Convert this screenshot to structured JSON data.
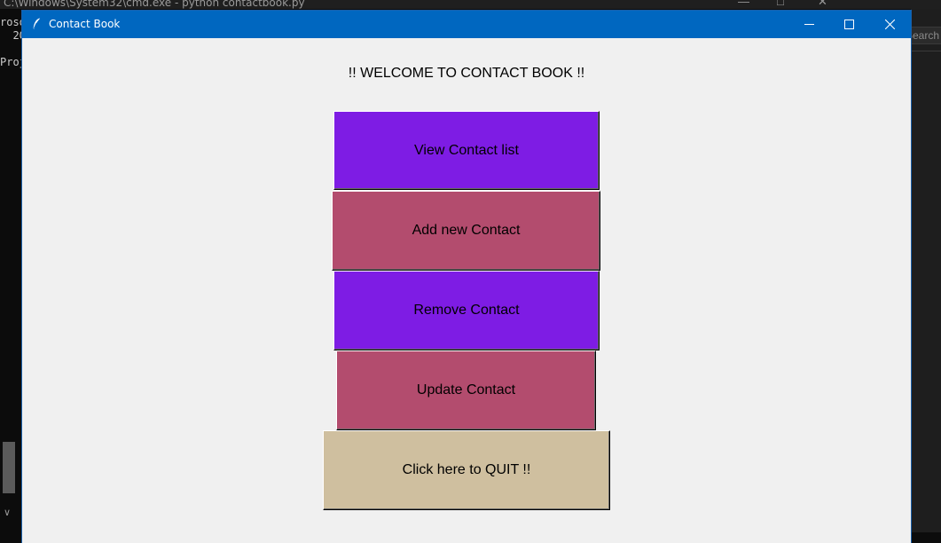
{
  "background_console": {
    "title": "C:\\Windows\\System32\\cmd.exe - python  contactbook.py",
    "lines": [
      "roso",
      "  20",
      "",
      "Proj"
    ],
    "right_panel_text": "Search"
  },
  "window": {
    "title": "Contact Book",
    "titlebar_color": "#0067c0"
  },
  "welcome_text": "!! WELCOME TO CONTACT BOOK !!",
  "buttons": {
    "view": {
      "label": "View Contact list",
      "color": "#7e1ce4"
    },
    "add": {
      "label": "Add new Contact",
      "color": "#b34c6e"
    },
    "remove": {
      "label": "Remove Contact",
      "color": "#7e1ce4"
    },
    "update": {
      "label": "Update Contact",
      "color": "#b34c6e"
    },
    "quit": {
      "label": "Click here to QUIT !!",
      "color": "#cfbf9f"
    }
  },
  "icons": {
    "app": "feather-icon",
    "minimize": "minimize-icon",
    "maximize": "maximize-icon",
    "close": "close-icon"
  }
}
